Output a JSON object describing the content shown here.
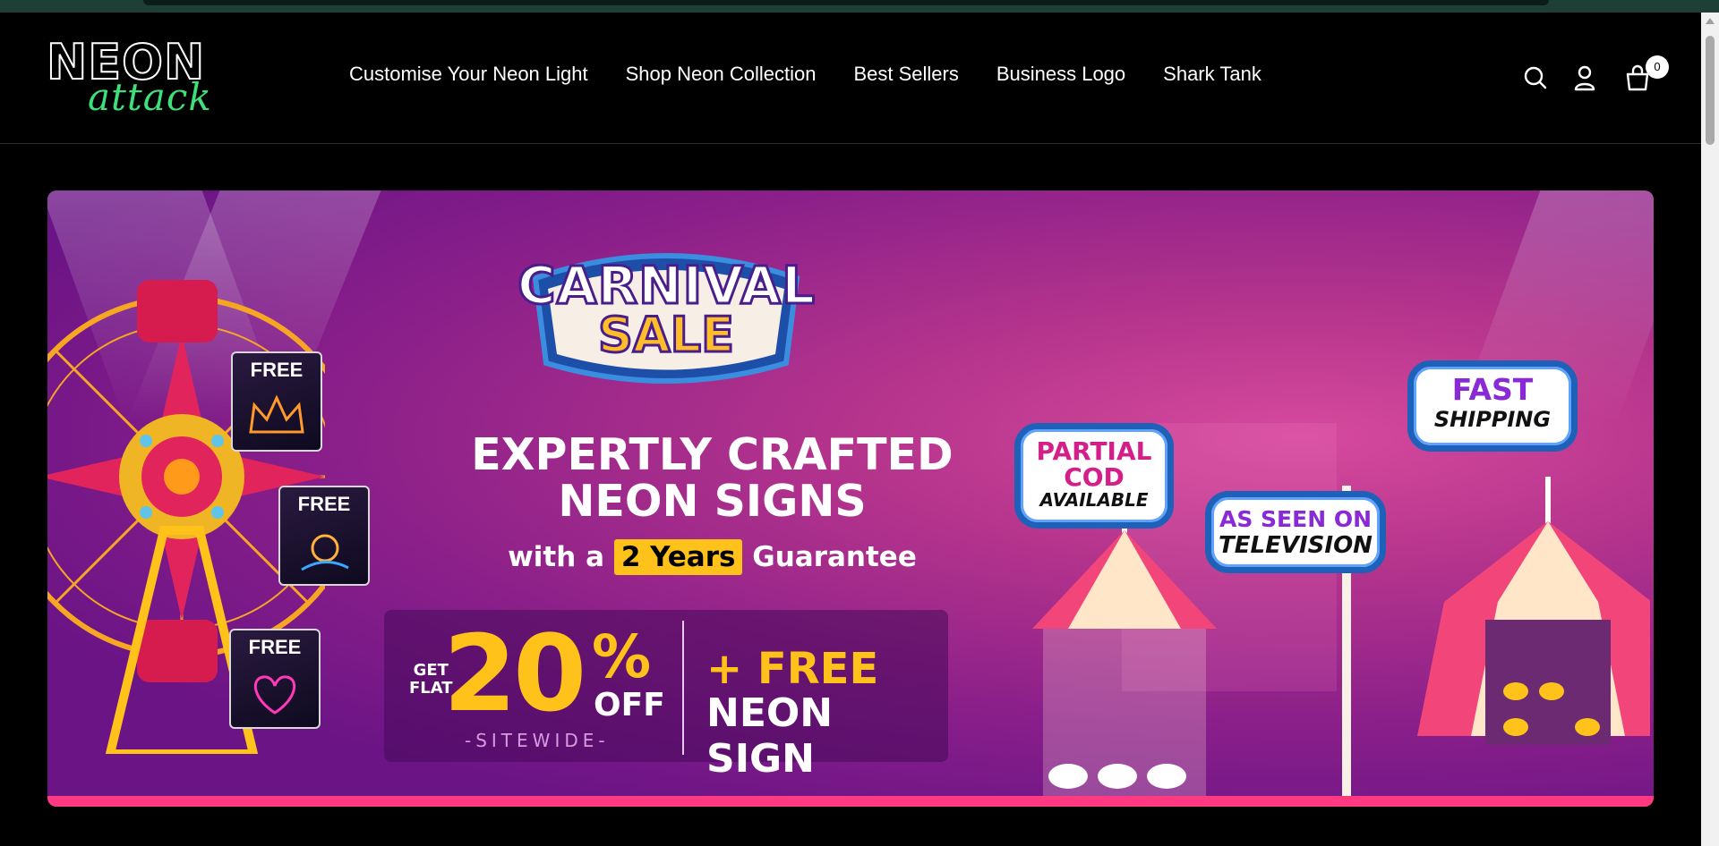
{
  "header": {
    "logo": {
      "word_top": "NEON",
      "word_bottom": "attack"
    },
    "nav": [
      {
        "label": "Customise Your Neon Light"
      },
      {
        "label": "Shop Neon Collection"
      },
      {
        "label": "Best Sellers"
      },
      {
        "label": "Business Logo"
      },
      {
        "label": "Shark Tank"
      }
    ],
    "icons": [
      "search-icon",
      "account-icon",
      "cart-icon"
    ],
    "cart_count": "0"
  },
  "banner": {
    "sale_sign": {
      "line1": "CARNIVAL",
      "line2": "SALE"
    },
    "headline": {
      "line1": "EXPERTLY CRAFTED",
      "line2": "NEON SIGNS"
    },
    "guarantee": {
      "prefix": "with a",
      "highlight": "2 Years",
      "suffix": "Guarantee"
    },
    "offer": {
      "get_flat_1": "GET",
      "get_flat_2": "FLAT",
      "percent": "20",
      "percent_sign": "%",
      "off": "OFF",
      "sitewide": "-SITEWIDE-",
      "plus_free": "+ FREE",
      "neon_sign": "NEON SIGN"
    },
    "free_cards": [
      {
        "label": "FREE",
        "icon": "crown-neon-icon"
      },
      {
        "label": "FREE",
        "icon": "neon-light-icon"
      },
      {
        "label": "FREE",
        "icon": "heart-neon-icon"
      }
    ],
    "signs": {
      "partial_cod": {
        "line1": "PARTIAL",
        "line2": "COD",
        "line3": "AVAILABLE"
      },
      "television": {
        "line1": "AS SEEN ON",
        "line2": "TELEVISION"
      },
      "shipping": {
        "line1": "FAST",
        "line2": "SHIPPING"
      }
    },
    "colors": {
      "accent_yellow": "#ffc21a",
      "accent_pink": "#ff3a82",
      "background_purple": "#7a1a94"
    }
  }
}
